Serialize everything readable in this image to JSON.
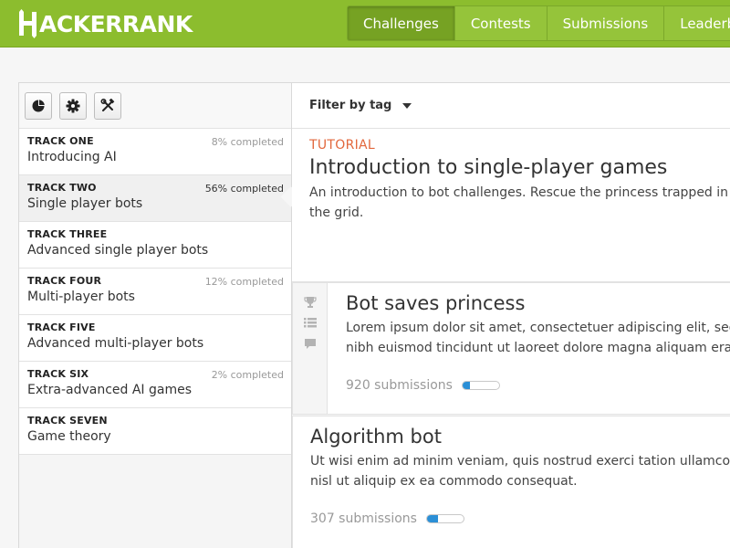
{
  "header": {
    "logo_text": "ACKERRANK",
    "logo_full": "HACKERRANK",
    "nav": [
      {
        "label": "Challenges",
        "active": true
      },
      {
        "label": "Contests",
        "active": false
      },
      {
        "label": "Submissions",
        "active": false
      },
      {
        "label": "Leaderbo",
        "active": false
      }
    ]
  },
  "toolbar": {
    "icons": [
      "pie-chart-icon",
      "gear-icon",
      "tools-icon"
    ]
  },
  "tracks": [
    {
      "number": "TRACK ONE",
      "name": "Introducing AI",
      "progress": "8% completed",
      "active": false
    },
    {
      "number": "TRACK TWO",
      "name": "Single player bots",
      "progress": "56% completed",
      "active": true
    },
    {
      "number": "TRACK THREE",
      "name": "Advanced single player bots",
      "progress": "",
      "active": false
    },
    {
      "number": "TRACK FOUR",
      "name": "Multi-player bots",
      "progress": "12% completed",
      "active": false
    },
    {
      "number": "TRACK FIVE",
      "name": "Advanced multi-player bots",
      "progress": "",
      "active": false
    },
    {
      "number": "TRACK SIX",
      "name": "Extra-advanced AI games",
      "progress": "2% completed",
      "active": false
    },
    {
      "number": "TRACK SEVEN",
      "name": "Game theory",
      "progress": "",
      "active": false
    }
  ],
  "filter": {
    "label": "Filter by tag"
  },
  "intro": {
    "tag": "TUTORIAL",
    "title": "Introduction to single-player games",
    "description": "An introduction to bot challenges. Rescue the princess trapped in the grid."
  },
  "challenges": [
    {
      "title": "Bot saves princess",
      "description_line1": "Lorem ipsum dolor sit amet, consectetuer adipiscing elit, sed di",
      "description_line2": "nibh euismod tincidunt ut laoreet dolore magna aliquam erat vo",
      "submissions": "920 submissions",
      "progress": 0.2,
      "rail_icons": [
        "trophy-icon",
        "list-icon",
        "comment-icon"
      ]
    },
    {
      "title": "Algorithm bot",
      "description_line1": "Ut wisi enim ad minim veniam, quis nostrud exerci tation ullamcorper",
      "description_line2": "nisl ut aliquip ex ea commodo consequat.",
      "submissions": "307 submissions",
      "progress": 0.3
    }
  ],
  "colors": {
    "brand_green": "#8cbd2e",
    "accent_orange": "#e2673c",
    "progress_blue": "#2b8fd6"
  }
}
